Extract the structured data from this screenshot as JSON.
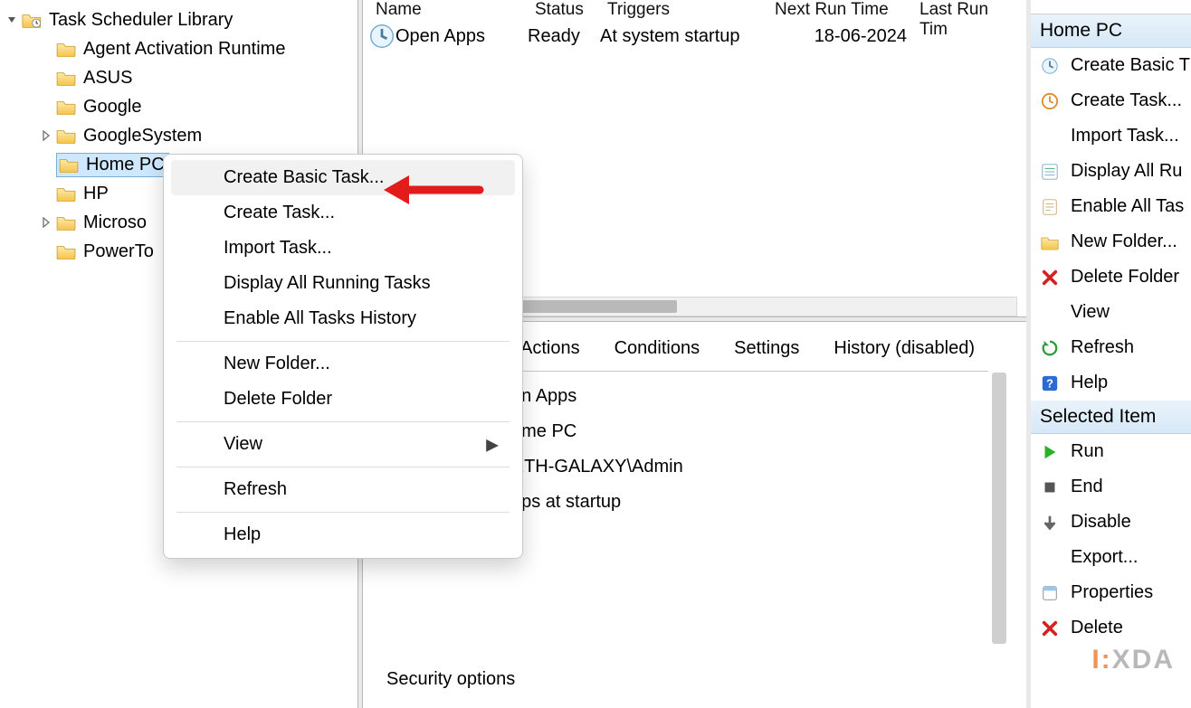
{
  "tree": {
    "root": "Task Scheduler Library",
    "items": [
      {
        "label": "Agent Activation Runtime",
        "indent": 72,
        "expander": ""
      },
      {
        "label": "ASUS",
        "indent": 72,
        "expander": ""
      },
      {
        "label": "Google",
        "indent": 72,
        "expander": ""
      },
      {
        "label": "GoogleSystem",
        "indent": 72,
        "expander": "closed"
      },
      {
        "label": "Home PC",
        "indent": 72,
        "expander": "",
        "selected": true
      },
      {
        "label": "HP",
        "indent": 72,
        "expander": ""
      },
      {
        "label": "Microso",
        "indent": 72,
        "expander": "closed"
      },
      {
        "label": "PowerTo",
        "indent": 72,
        "expander": ""
      }
    ]
  },
  "table": {
    "headers": {
      "name": "Name",
      "status": "Status",
      "triggers": "Triggers",
      "next": "Next Run Time",
      "last": "Last Run Tim"
    },
    "rows": [
      {
        "name": "Open Apps",
        "status": "Ready",
        "triggers": "At system startup",
        "next": "18-06-2024",
        "last": ""
      }
    ]
  },
  "tabs": [
    "Actions",
    "Conditions",
    "Settings",
    "History (disabled)"
  ],
  "details": {
    "l1": "en Apps",
    "l2": "ome PC",
    "l3": "RTH-GALAXY\\Admin",
    "l4": "pps at startup"
  },
  "security_heading": "Security options",
  "context_menu": {
    "create_basic": "Create Basic Task...",
    "create_task": "Create Task...",
    "import_task": "Import Task...",
    "display_running": "Display All Running Tasks",
    "enable_history": "Enable All Tasks History",
    "new_folder": "New Folder...",
    "delete_folder": "Delete Folder",
    "view": "View",
    "refresh": "Refresh",
    "help": "Help"
  },
  "actions_pane": {
    "section1": "Home PC",
    "s1_items": {
      "create_basic": "Create Basic T",
      "create_task": "Create Task...",
      "import_task": "Import Task...",
      "display_running": "Display All Ru",
      "enable_history": "Enable All Tas",
      "new_folder": "New Folder...",
      "delete_folder": "Delete Folder",
      "view": "View",
      "refresh": "Refresh",
      "help": "Help"
    },
    "section2": "Selected Item",
    "s2_items": {
      "run": "Run",
      "end": "End",
      "disable": "Disable",
      "export": "Export...",
      "properties": "Properties",
      "delete": "Delete"
    }
  },
  "watermark": {
    "a": "I:",
    "b": "X",
    "c": "DA"
  }
}
